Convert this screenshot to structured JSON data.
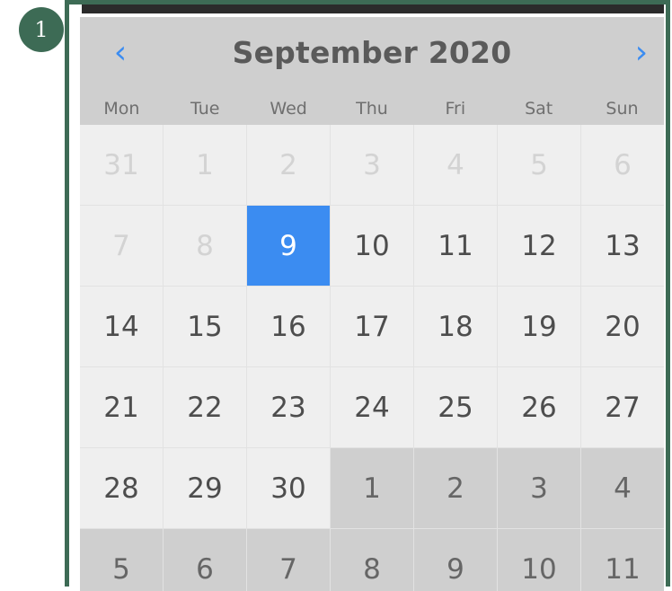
{
  "badge": {
    "label": "1"
  },
  "calendar": {
    "title": "September 2020",
    "prev_icon": "chevron-left-icon",
    "next_icon": "chevron-right-icon",
    "weekdays": [
      "Mon",
      "Tue",
      "Wed",
      "Thu",
      "Fri",
      "Sat",
      "Sun"
    ],
    "days": [
      {
        "label": "31",
        "state": "muted"
      },
      {
        "label": "1",
        "state": "muted"
      },
      {
        "label": "2",
        "state": "muted"
      },
      {
        "label": "3",
        "state": "muted"
      },
      {
        "label": "4",
        "state": "muted"
      },
      {
        "label": "5",
        "state": "muted"
      },
      {
        "label": "6",
        "state": "muted"
      },
      {
        "label": "7",
        "state": "muted"
      },
      {
        "label": "8",
        "state": "muted"
      },
      {
        "label": "9",
        "state": "selected"
      },
      {
        "label": "10",
        "state": "normal"
      },
      {
        "label": "11",
        "state": "normal"
      },
      {
        "label": "12",
        "state": "normal"
      },
      {
        "label": "13",
        "state": "normal"
      },
      {
        "label": "14",
        "state": "normal"
      },
      {
        "label": "15",
        "state": "normal"
      },
      {
        "label": "16",
        "state": "normal"
      },
      {
        "label": "17",
        "state": "normal"
      },
      {
        "label": "18",
        "state": "normal"
      },
      {
        "label": "19",
        "state": "normal"
      },
      {
        "label": "20",
        "state": "normal"
      },
      {
        "label": "21",
        "state": "normal"
      },
      {
        "label": "22",
        "state": "normal"
      },
      {
        "label": "23",
        "state": "normal"
      },
      {
        "label": "24",
        "state": "normal"
      },
      {
        "label": "25",
        "state": "normal"
      },
      {
        "label": "26",
        "state": "normal"
      },
      {
        "label": "27",
        "state": "normal"
      },
      {
        "label": "28",
        "state": "normal"
      },
      {
        "label": "29",
        "state": "normal"
      },
      {
        "label": "30",
        "state": "normal"
      },
      {
        "label": "1",
        "state": "next-month"
      },
      {
        "label": "2",
        "state": "next-month"
      },
      {
        "label": "3",
        "state": "next-month"
      },
      {
        "label": "4",
        "state": "next-month"
      },
      {
        "label": "5",
        "state": "next-month"
      },
      {
        "label": "6",
        "state": "next-month"
      },
      {
        "label": "7",
        "state": "next-month"
      },
      {
        "label": "8",
        "state": "next-month"
      },
      {
        "label": "9",
        "state": "next-month"
      },
      {
        "label": "10",
        "state": "next-month"
      },
      {
        "label": "11",
        "state": "next-month"
      }
    ]
  },
  "colors": {
    "accent": "#3b8cf1",
    "frame": "#3d6b55",
    "header_bg": "#cfcfcf"
  }
}
